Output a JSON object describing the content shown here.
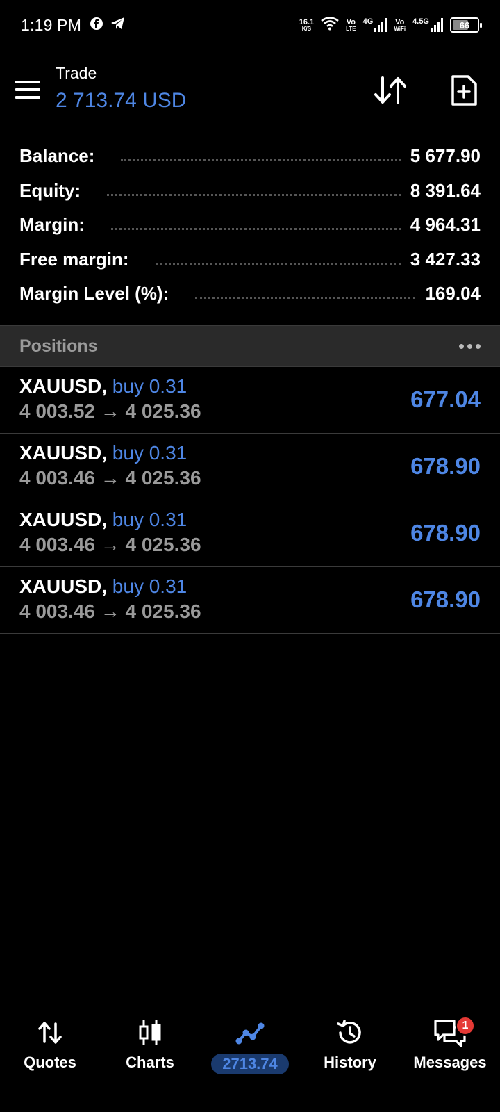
{
  "status": {
    "time": "1:19 PM",
    "speed_value": "16.1",
    "speed_unit": "K/S",
    "volte1_top": "Vo",
    "volte1_bottom": "LTE",
    "net1": "4G",
    "vowifi_top": "Vo",
    "vowifi_bottom": "WiFi",
    "net2": "4.5G",
    "battery": "66",
    "battery_level": 0.66
  },
  "header": {
    "title": "Trade",
    "subtitle": "2 713.74 USD"
  },
  "summary": [
    {
      "label": "Balance:",
      "value": "5 677.90"
    },
    {
      "label": "Equity:",
      "value": "8 391.64"
    },
    {
      "label": "Margin:",
      "value": "4 964.31"
    },
    {
      "label": "Free margin:",
      "value": "3 427.33"
    },
    {
      "label": "Margin Level (%):",
      "value": "169.04"
    }
  ],
  "positions": {
    "title": "Positions",
    "items": [
      {
        "symbol": "XAUUSD,",
        "type": "buy 0.31",
        "prices": "4 003.52 → 4 025.36",
        "profit": "677.04"
      },
      {
        "symbol": "XAUUSD,",
        "type": "buy 0.31",
        "prices": "4 003.46 → 4 025.36",
        "profit": "678.90"
      },
      {
        "symbol": "XAUUSD,",
        "type": "buy 0.31",
        "prices": "4 003.46 → 4 025.36",
        "profit": "678.90"
      },
      {
        "symbol": "XAUUSD,",
        "type": "buy 0.31",
        "prices": "4 003.46 → 4 025.36",
        "profit": "678.90"
      }
    ]
  },
  "nav": {
    "items": [
      {
        "label": "Quotes",
        "icon": "quotes-arrows-icon"
      },
      {
        "label": "Charts",
        "icon": "candlestick-icon"
      },
      {
        "label": "2713.74",
        "icon": "trade-line-icon",
        "active": true
      },
      {
        "label": "History",
        "icon": "history-icon"
      },
      {
        "label": "Messages",
        "icon": "messages-icon",
        "badge": "1"
      }
    ]
  },
  "colors": {
    "accent": "#4e86e4",
    "background": "#000000",
    "section_header": "#2a2a2a",
    "badge": "#e53935"
  }
}
